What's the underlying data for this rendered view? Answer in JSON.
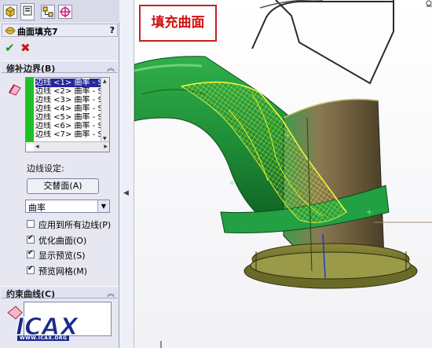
{
  "feature": {
    "title": "曲面填充7",
    "help": "?",
    "ok_icon": "check-icon",
    "cancel_icon": "x-icon"
  },
  "tabs": [
    {
      "icon": "feature-manager-icon"
    },
    {
      "icon": "property-manager-icon"
    },
    {
      "icon": "configuration-manager-icon"
    },
    {
      "icon": "dimxpert-icon"
    }
  ],
  "patch_boundary": {
    "title": "修补边界(B)",
    "edges": [
      "边线 <1> 曲率 - S",
      "边线 <2> 曲率 - S",
      "边线 <3> 曲率 - S",
      "边线 <4> 曲率 - S",
      "边线 <5> 曲率 - S",
      "边线 <6> 曲率 - S",
      "边线 <7> 曲率 - S"
    ],
    "selected_index": 0,
    "edge_settings_label": "边线设定:",
    "swap_button": "交替面(A)",
    "curvature_value": "曲率",
    "apply_all": {
      "label": "应用到所有边线(P)",
      "checked": false
    },
    "optimize": {
      "label": "优化曲面(O)",
      "checked": true
    },
    "show_preview": {
      "label": "显示预览(S)",
      "checked": true
    },
    "preview_mesh": {
      "label": "预览网格(M)",
      "checked": true
    }
  },
  "constraint_curves": {
    "title": "约束曲线(C)"
  },
  "watermark": {
    "logo": "ICAX",
    "url": "WWW.ICAX.ORG"
  },
  "annotation": {
    "text": "填充曲面"
  },
  "colors": {
    "accent_green": "#1fbf27",
    "selection_blue": "#24289a",
    "annotation_red": "#d01010",
    "cad_body_green": "#1e9c3a",
    "preview_yellow": "#e4ef3a",
    "cylinder_brown": "#7a6a48"
  }
}
